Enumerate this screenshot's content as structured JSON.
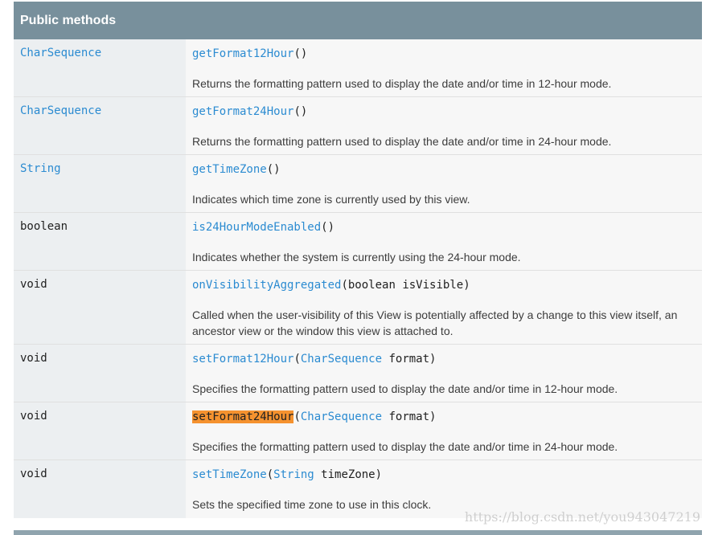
{
  "header": {
    "title": "Public methods"
  },
  "rows": [
    {
      "type": "CharSequence",
      "type_is_link": true,
      "method": "getFormat12Hour",
      "args": "()",
      "description": "Returns the formatting pattern used to display the date and/or time in 12-hour mode."
    },
    {
      "type": "CharSequence",
      "type_is_link": true,
      "method": "getFormat24Hour",
      "args": "()",
      "description": "Returns the formatting pattern used to display the date and/or time in 24-hour mode."
    },
    {
      "type": "String",
      "type_is_link": true,
      "method": "getTimeZone",
      "args": "()",
      "description": "Indicates which time zone is currently used by this view."
    },
    {
      "type": "boolean",
      "type_is_link": false,
      "method": "is24HourModeEnabled",
      "args": "()",
      "description": "Indicates whether the system is currently using the 24-hour mode."
    },
    {
      "type": "void",
      "type_is_link": false,
      "method": "onVisibilityAggregated",
      "args_open": "(",
      "param_type": "boolean",
      "param_name": "isVisible",
      "args_close": ")",
      "description": "Called when the user-visibility of this View is potentially affected by a change to this view itself, an ancestor view or the window this view is attached to."
    },
    {
      "type": "void",
      "type_is_link": false,
      "method": "setFormat12Hour",
      "args_open": "(",
      "param_type": "CharSequence",
      "param_name": "format",
      "args_close": ")",
      "description": "Specifies the formatting pattern used to display the date and/or time in 12-hour mode."
    },
    {
      "type": "void",
      "type_is_link": false,
      "method": "setFormat24Hour",
      "highlighted": true,
      "args_open": "(",
      "param_type": "CharSequence",
      "param_name": "format",
      "args_close": ")",
      "description": "Specifies the formatting pattern used to display the date and/or time in 24-hour mode."
    },
    {
      "type": "void",
      "type_is_link": false,
      "method": "setTimeZone",
      "args_open": "(",
      "param_type": "String",
      "param_name": "timeZone",
      "args_close": ")",
      "description": "Sets the specified time zone to use in this clock."
    }
  ],
  "colors": {
    "header_bg": "#78909c",
    "link": "#2b8bd1",
    "highlight": "#f5922f",
    "type_cell_bg": "#eceff1"
  },
  "watermark": "https://blog.csdn.net/you943047219"
}
